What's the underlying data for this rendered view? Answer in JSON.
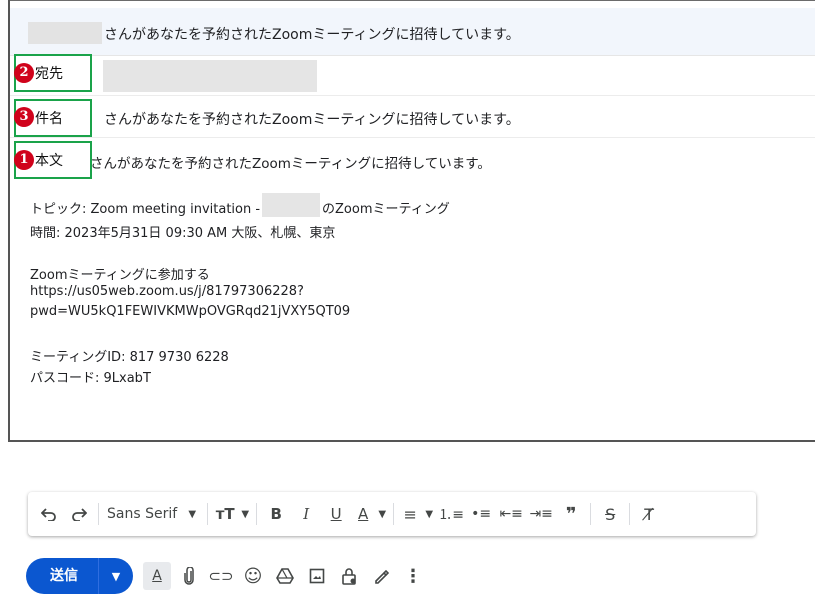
{
  "header": {
    "title": "さんがあなたを予約されたZoomミーティングに招待しています。"
  },
  "fields": {
    "to": {
      "badge": "2",
      "label": "宛先"
    },
    "subject": {
      "badge": "3",
      "label": "件名",
      "value": "さんがあなたを予約されたZoomミーティングに招待しています。"
    },
    "body": {
      "badge": "1",
      "label": "本文"
    }
  },
  "body_lines": {
    "first": "さんがあなたを予約されたZoomミーティングに招待しています。",
    "topic_prefix": "トピック: Zoom meeting invitation -",
    "topic_suffix": "のZoomミーティング",
    "time": "時間: 2023年5月31日 09:30 AM 大阪、札幌、東京",
    "join": "Zoomミーティングに参加する",
    "url1": "https://us05web.zoom.us/j/81797306228?",
    "url2": "pwd=WU5kQ1FEWIVKMWpOVGRqd21jVXY5QT09",
    "meeting_id": "ミーティングID: 817 9730 6228",
    "passcode": "パスコード: 9LxabT"
  },
  "toolbar": {
    "font_name": "Sans Serif"
  },
  "bottom": {
    "send_label": "送信"
  },
  "colors": {
    "send": "#0b57d0",
    "badge": "#d0021b",
    "box": "#1aa34a"
  }
}
